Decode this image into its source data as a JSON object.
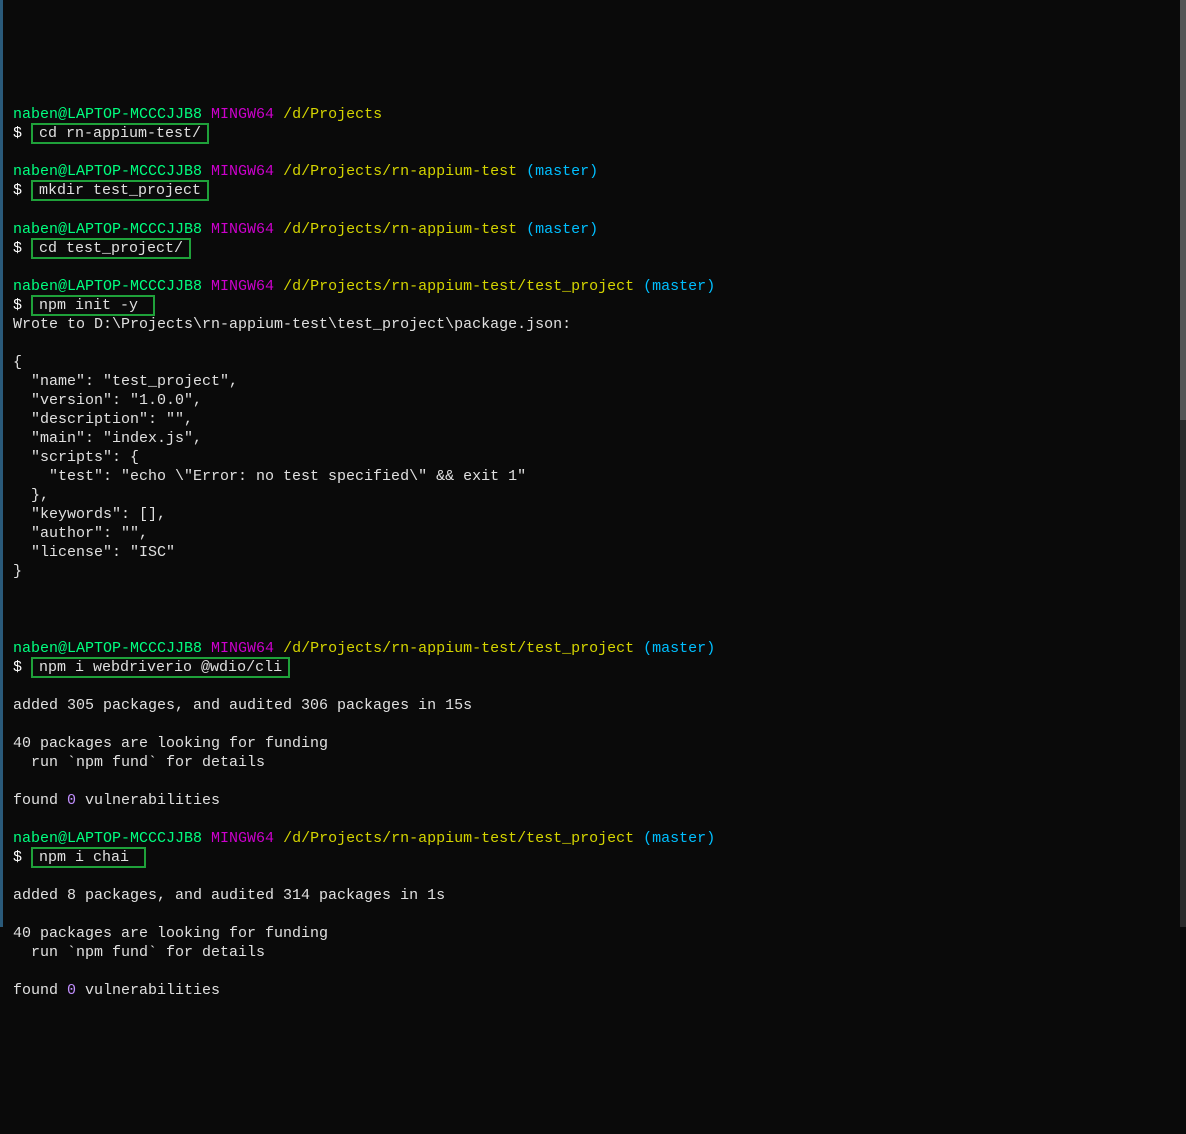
{
  "p1": {
    "user": "naben@LAPTOP-MCCCJJB8",
    "host": "MINGW64",
    "path": "/d/Projects",
    "cmd": "cd rn-appium-test/"
  },
  "p2": {
    "user": "naben@LAPTOP-MCCCJJB8",
    "host": "MINGW64",
    "path": "/d/Projects/rn-appium-test",
    "branch": "master",
    "cmd": "mkdir test_project"
  },
  "p3": {
    "user": "naben@LAPTOP-MCCCJJB8",
    "host": "MINGW64",
    "path": "/d/Projects/rn-appium-test",
    "branch": "master",
    "cmd": "cd test_project/"
  },
  "p4": {
    "user": "naben@LAPTOP-MCCCJJB8",
    "host": "MINGW64",
    "path": "/d/Projects/rn-appium-test/test_project",
    "branch": "master",
    "cmd": "npm init -y "
  },
  "o4a": "Wrote to D:\\Projects\\rn-appium-test\\test_project\\package.json:",
  "o4b": "{\n  \"name\": \"test_project\",\n  \"version\": \"1.0.0\",\n  \"description\": \"\",\n  \"main\": \"index.js\",\n  \"scripts\": {\n    \"test\": \"echo \\\"Error: no test specified\\\" && exit 1\"\n  },\n  \"keywords\": [],\n  \"author\": \"\",\n  \"license\": \"ISC\"\n}",
  "p5": {
    "user": "naben@LAPTOP-MCCCJJB8",
    "host": "MINGW64",
    "path": "/d/Projects/rn-appium-test/test_project",
    "branch": "master",
    "cmd": "npm i webdriverio @wdio/cli"
  },
  "o5a": "added 305 packages, and audited 306 packages in 15s",
  "o5b": "40 packages are looking for funding\n  run `npm fund` for details",
  "o5c_pre": "found ",
  "o5c_zero": "0",
  "o5c_post": " vulnerabilities",
  "p6": {
    "user": "naben@LAPTOP-MCCCJJB8",
    "host": "MINGW64",
    "path": "/d/Projects/rn-appium-test/test_project",
    "branch": "master",
    "cmd": "npm i chai "
  },
  "o6a": "added 8 packages, and audited 314 packages in 1s",
  "o6b": "40 packages are looking for funding\n  run `npm fund` for details",
  "o6c_pre": "found ",
  "o6c_zero": "0",
  "o6c_post": " vulnerabilities",
  "dollar": "$",
  "lp": "(",
  "rp": ")"
}
